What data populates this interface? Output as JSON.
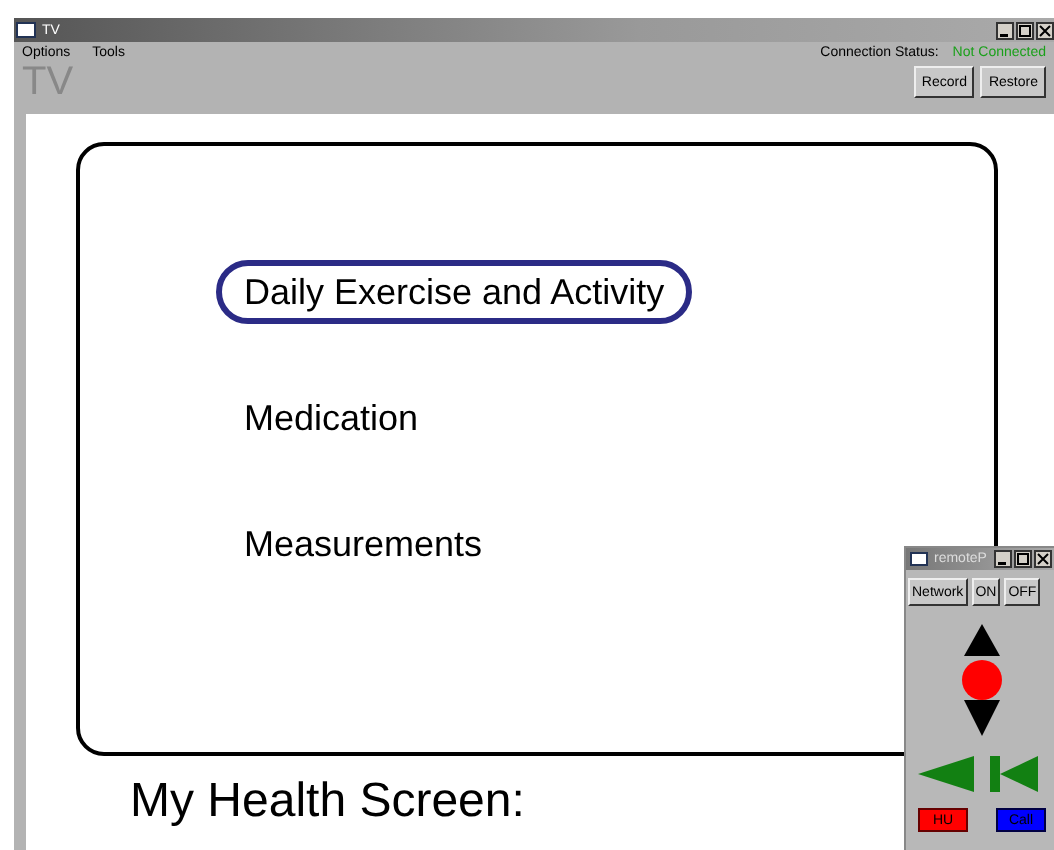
{
  "window": {
    "title": "TV"
  },
  "menu": [
    "Options",
    "Tools"
  ],
  "app_title": "TV",
  "connection": {
    "label": "Connection Status:",
    "value": "Not Connected"
  },
  "toolbar_buttons": [
    "Record",
    "Restore"
  ],
  "menu_items": [
    {
      "label": "Daily Exercise and Activity",
      "selected": true
    },
    {
      "label": "Medication",
      "selected": false
    },
    {
      "label": "Measurements",
      "selected": false
    }
  ],
  "screen_label": "My Health Screen:",
  "remote": {
    "title": "remoteP",
    "buttons": [
      "Network",
      "ON",
      "OFF"
    ],
    "hang_up": "HU",
    "call": "Call"
  }
}
